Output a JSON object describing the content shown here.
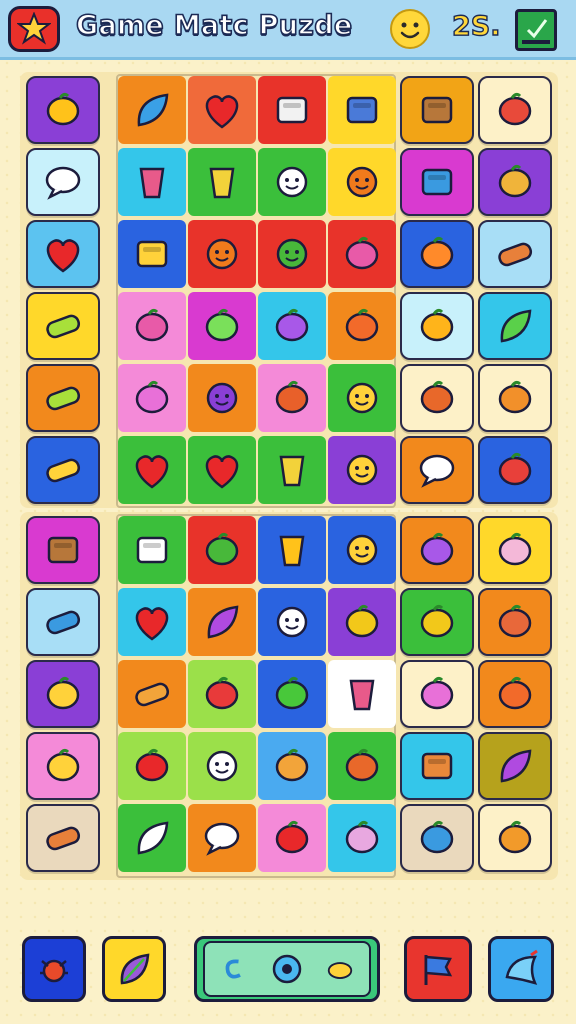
{
  "header": {
    "title": "Game Matc Puzde",
    "score": "2S.",
    "icons": [
      "star-icon",
      "smiley-icon",
      "menu-icon"
    ],
    "colors": {
      "bar": "#a9d8f2",
      "star_button": "#e9302a",
      "menu_button": "#2aa64a"
    }
  },
  "board_top": {
    "rows": [
      [
        "purple|beetles",
        "orange|rocket",
        "coral|heart",
        "red|jar",
        "yellow|phone",
        "amber|box",
        "cream|meat"
      ],
      [
        "lightcyan|chat",
        "cyan|cup",
        "green|glass",
        "green|face",
        "yellow|gear",
        "magenta|radio",
        "purple|shell"
      ],
      [
        "skyblue|heart",
        "blue|dice",
        "red|gear",
        "red|virus",
        "red|robot",
        "blue|trumpet",
        "lightblue|log"
      ],
      [
        "yellow|candy",
        "pink|robot",
        "magenta|alarm",
        "cyan|plum",
        "orange|fruit",
        "lightcyan|lemon",
        "cyan|pepper"
      ],
      [
        "orange|candy",
        "pink|pumpkin",
        "orange|planet",
        "pink|cake",
        "green|sun",
        "cream|horn",
        "cream|splat"
      ],
      [
        "blue|corn",
        "green|heart",
        "green|heart",
        "green|glass",
        "purple|sun",
        "orange|chat",
        "blue|jelly"
      ]
    ]
  },
  "board_bottom": {
    "rows": [
      [
        "magenta|box",
        "green|book",
        "red|melon",
        "blue|pot",
        "blue|sun",
        "orange|plum",
        "yellow|bird"
      ],
      [
        "lightblue|tube",
        "cyan|heart",
        "orange|leaf",
        "blue|face",
        "purple|mango",
        "green|star",
        "orange|swirl"
      ],
      [
        "purple|shovel",
        "orange|scroll",
        "lime|bow",
        "blue|strawberry",
        "white|cup",
        "cream|pumpkin",
        "orange|fruit"
      ],
      [
        "pink|turtle",
        "lime|apple",
        "lime|face",
        "sky|guitar",
        "green|fries",
        "cyan|crate",
        "olive|leaf"
      ],
      [
        "beige|log",
        "green|cone",
        "orange|egg",
        "pink|apple",
        "cyan|onion",
        "beige|wave",
        "cream|croissant"
      ]
    ]
  },
  "toolbar": {
    "buttons": [
      {
        "name": "bug-button",
        "color": "#1c3fd6",
        "icon": "bug-icon"
      },
      {
        "name": "leaf-button",
        "color": "#ffd82a",
        "icon": "leaf-icon"
      },
      {
        "name": "powerups-button",
        "color": "#3ac87a",
        "icon": "gear-icon"
      },
      {
        "name": "flag-button",
        "color": "#e8352e",
        "icon": "flag-icon"
      },
      {
        "name": "bird-button",
        "color": "#3aa8f0",
        "icon": "bird-icon"
      }
    ]
  }
}
